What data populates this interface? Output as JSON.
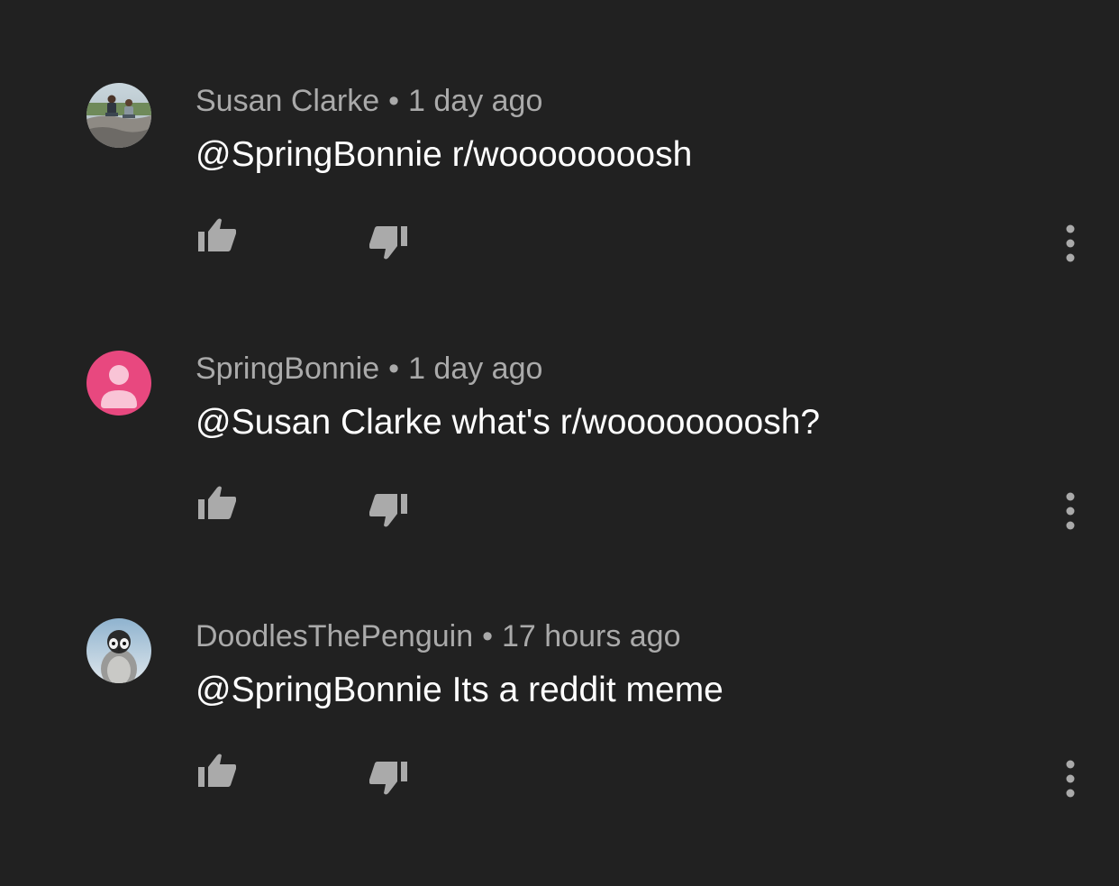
{
  "colors": {
    "background": "#212121",
    "meta_text": "#aaaaaa",
    "body_text": "#ffffff",
    "icon": "#aaaaaa",
    "default_avatar_bg": "#e8487f",
    "default_avatar_fg": "#f9c4d6"
  },
  "comments": [
    {
      "author": "Susan Clarke",
      "separator": "•",
      "time": "1 day ago",
      "text": "@SpringBonnie r/woooooooosh",
      "avatar": "photo-avatar-two-kids",
      "icons": [
        "thumbs-up-icon",
        "thumbs-down-icon",
        "more-vert-icon"
      ]
    },
    {
      "author": "SpringBonnie",
      "separator": "•",
      "time": "1 day ago",
      "text": "@Susan Clarke what's r/woooooooosh?",
      "avatar": "default-person-avatar",
      "icons": [
        "thumbs-up-icon",
        "thumbs-down-icon",
        "more-vert-icon"
      ]
    },
    {
      "author": "DoodlesThePenguin",
      "separator": "•",
      "time": "17 hours ago",
      "text": "@SpringBonnie Its a reddit meme",
      "avatar": "penguin-avatar",
      "icons": [
        "thumbs-up-icon",
        "thumbs-down-icon",
        "more-vert-icon"
      ]
    }
  ]
}
